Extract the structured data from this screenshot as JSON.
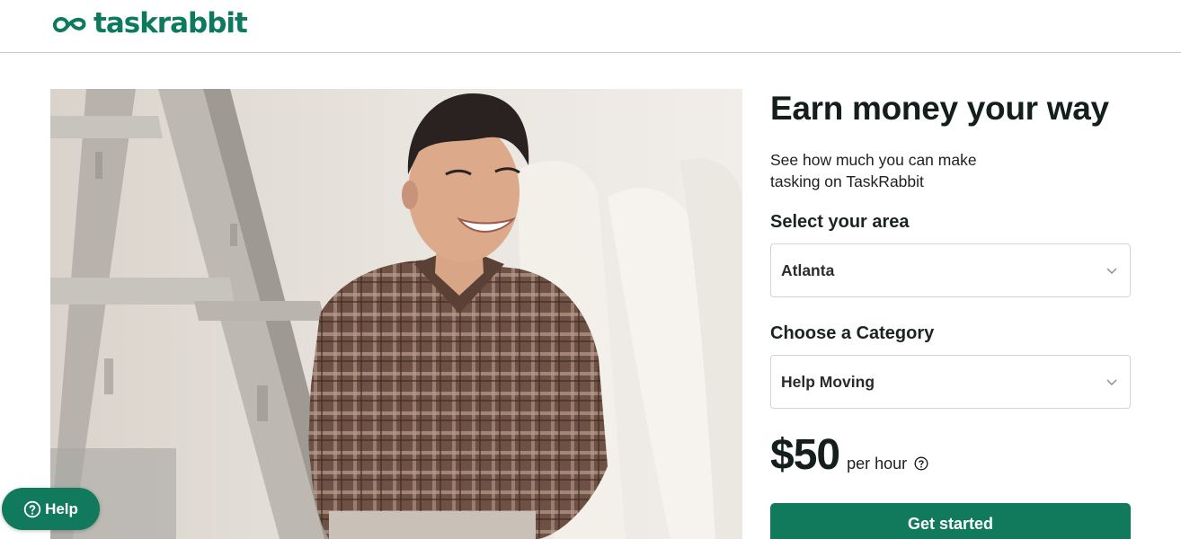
{
  "header": {
    "brand": "taskrabbit",
    "brand_color": "#0d7a5f"
  },
  "hero": {
    "image_icon": "photo-icon"
  },
  "panel": {
    "headline": "Earn money your way",
    "subtext": "See how much you can make tasking on TaskRabbit",
    "area_label": "Select your area",
    "area_value": "Atlanta",
    "category_label": "Choose a Category",
    "category_value": "Help Moving",
    "rate_amount": "$50",
    "rate_unit": "per hour",
    "cta_label": "Get started",
    "accent_color": "#117a5d"
  },
  "help": {
    "label": "Help"
  }
}
